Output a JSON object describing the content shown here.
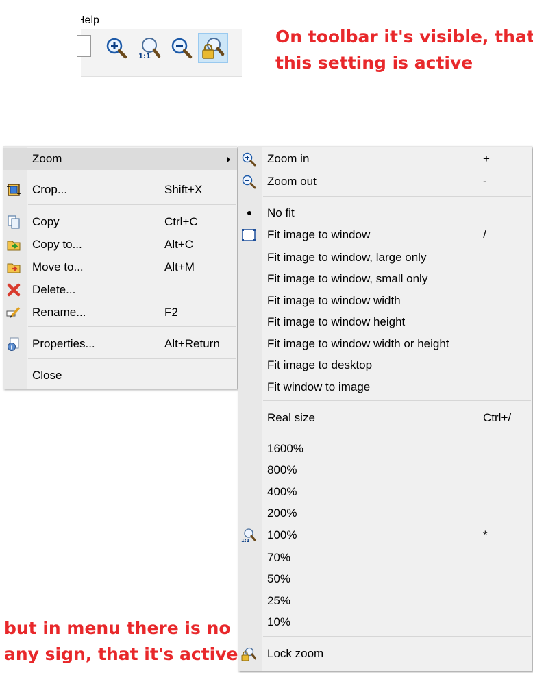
{
  "toolbar": {
    "menu_label": "Help",
    "buttons": [
      {
        "name": "zoom-in",
        "icon": "zoom-in-icon"
      },
      {
        "name": "zoom-1-1",
        "icon": "zoom-actual-size-icon"
      },
      {
        "name": "zoom-out",
        "icon": "zoom-out-icon"
      },
      {
        "name": "lock-zoom",
        "icon": "lock-zoom-icon",
        "active": true
      }
    ]
  },
  "annotations": {
    "top_line1": "On toolbar it's visible, that",
    "top_line2": "this setting is active",
    "bottom_line1": "but in menu there is no",
    "bottom_line2": "any sign, that it's active",
    "color": "#e8282b"
  },
  "context_menu": {
    "zoom": "Zoom",
    "crop": {
      "label": "Crop...",
      "key": "Shift+X"
    },
    "copy": {
      "label": "Copy",
      "key": "Ctrl+C"
    },
    "copy_to": {
      "label": "Copy to...",
      "key": "Alt+C"
    },
    "move_to": {
      "label": "Move to...",
      "key": "Alt+M"
    },
    "delete": {
      "label": "Delete...",
      "key": ""
    },
    "rename": {
      "label": "Rename...",
      "key": "F2"
    },
    "properties": {
      "label": "Properties...",
      "key": "Alt+Return"
    },
    "close": {
      "label": "Close",
      "key": ""
    }
  },
  "zoom_menu": {
    "zoom_in": {
      "label": "Zoom in",
      "key": "+"
    },
    "zoom_out": {
      "label": "Zoom out",
      "key": "-"
    },
    "no_fit": {
      "label": "No fit"
    },
    "fit_window": {
      "label": "Fit image to window",
      "key": "/"
    },
    "fit_large": {
      "label": "Fit image to window, large only"
    },
    "fit_small": {
      "label": "Fit image to window, small only"
    },
    "fit_width": {
      "label": "Fit image to window width"
    },
    "fit_height": {
      "label": "Fit image to window height"
    },
    "fit_width_height": {
      "label": "Fit image to window width or height"
    },
    "fit_desktop": {
      "label": "Fit image to desktop"
    },
    "fit_window_to_image": {
      "label": "Fit window to image"
    },
    "real_size": {
      "label": "Real size",
      "key": "Ctrl+/"
    },
    "z1600": "1600%",
    "z800": "800%",
    "z400": "400%",
    "z200": "200%",
    "z100": {
      "label": "100%",
      "key": "*"
    },
    "z70": "70%",
    "z50": "50%",
    "z25": "25%",
    "z10": "10%",
    "lock_zoom": {
      "label": "Lock zoom"
    }
  }
}
